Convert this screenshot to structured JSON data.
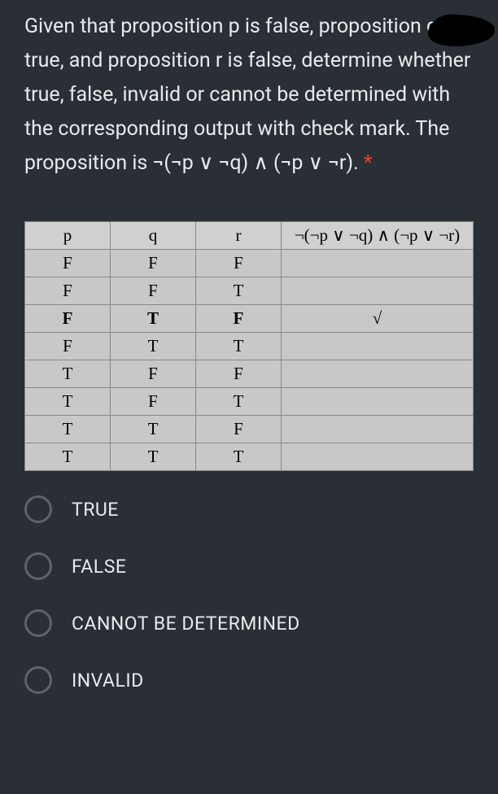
{
  "question": {
    "text_part1": "Given that proposition p is false, proposition q is true, and proposition r is false, determine whether true, false, invalid or cannot be determined with the corresponding output with check mark. The proposition is ¬(¬p ∨ ¬q) ∧ (¬p ∨ ¬r).",
    "required_mark": "*"
  },
  "table": {
    "headers": [
      "p",
      "q",
      "r",
      "¬(¬p ∨ ¬q) ∧ (¬p ∨ ¬r)"
    ],
    "rows": [
      {
        "cells": [
          "F",
          "F",
          "F",
          ""
        ],
        "highlight": false
      },
      {
        "cells": [
          "F",
          "F",
          "T",
          ""
        ],
        "highlight": false
      },
      {
        "cells": [
          "F",
          "T",
          "F",
          "√"
        ],
        "highlight": true
      },
      {
        "cells": [
          "F",
          "T",
          "T",
          ""
        ],
        "highlight": false
      },
      {
        "cells": [
          "T",
          "F",
          "F",
          ""
        ],
        "highlight": false
      },
      {
        "cells": [
          "T",
          "F",
          "T",
          ""
        ],
        "highlight": false
      },
      {
        "cells": [
          "T",
          "T",
          "F",
          ""
        ],
        "highlight": false
      },
      {
        "cells": [
          "T",
          "T",
          "T",
          ""
        ],
        "highlight": false
      }
    ]
  },
  "options": [
    {
      "id": "true",
      "label": "TRUE"
    },
    {
      "id": "false",
      "label": "FALSE"
    },
    {
      "id": "cannot",
      "label": "CANNOT BE DETERMINED"
    },
    {
      "id": "invalid",
      "label": "INVALID"
    }
  ]
}
